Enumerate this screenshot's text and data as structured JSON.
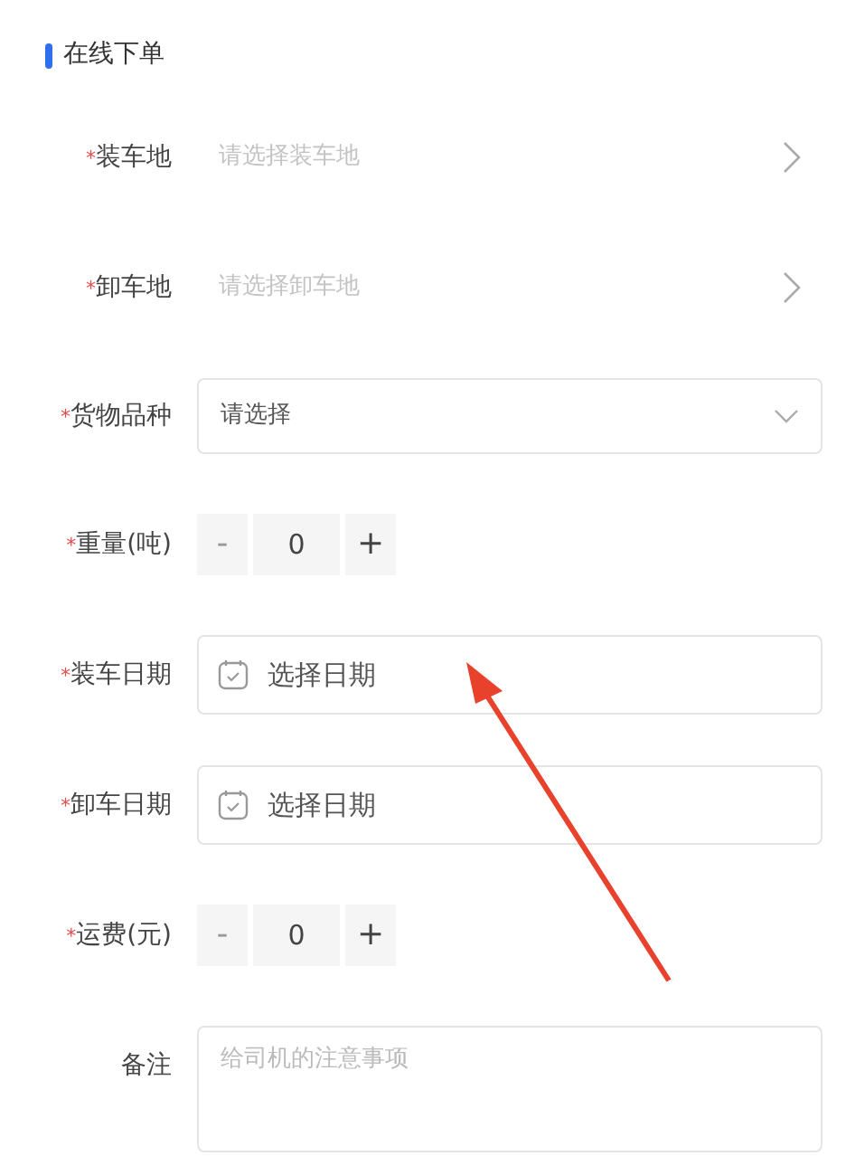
{
  "section_title": "在线下单",
  "fields": [
    {
      "kind": "picker",
      "required_mark": "*",
      "label": "装车地",
      "placeholder": "请选择装车地"
    },
    {
      "kind": "picker",
      "required_mark": "*",
      "label": "卸车地",
      "placeholder": "请选择卸车地"
    },
    {
      "kind": "select",
      "required_mark": "*",
      "label": "货物品种",
      "value": "请选择"
    },
    {
      "kind": "stepper",
      "required_mark": "*",
      "label": "重量(吨)",
      "minus": "-",
      "value": "0",
      "plus": "+",
      "minus_disabled": true
    },
    {
      "kind": "date",
      "required_mark": "*",
      "label": "装车日期",
      "placeholder": "选择日期"
    },
    {
      "kind": "date",
      "required_mark": "*",
      "label": "卸车日期",
      "placeholder": "选择日期"
    },
    {
      "kind": "stepper",
      "required_mark": "*",
      "label": "运费(元)",
      "minus": "-",
      "value": "0",
      "plus": "+",
      "minus_disabled": true
    },
    {
      "kind": "textarea",
      "label": "备注",
      "placeholder": "给司机的注意事项"
    }
  ]
}
